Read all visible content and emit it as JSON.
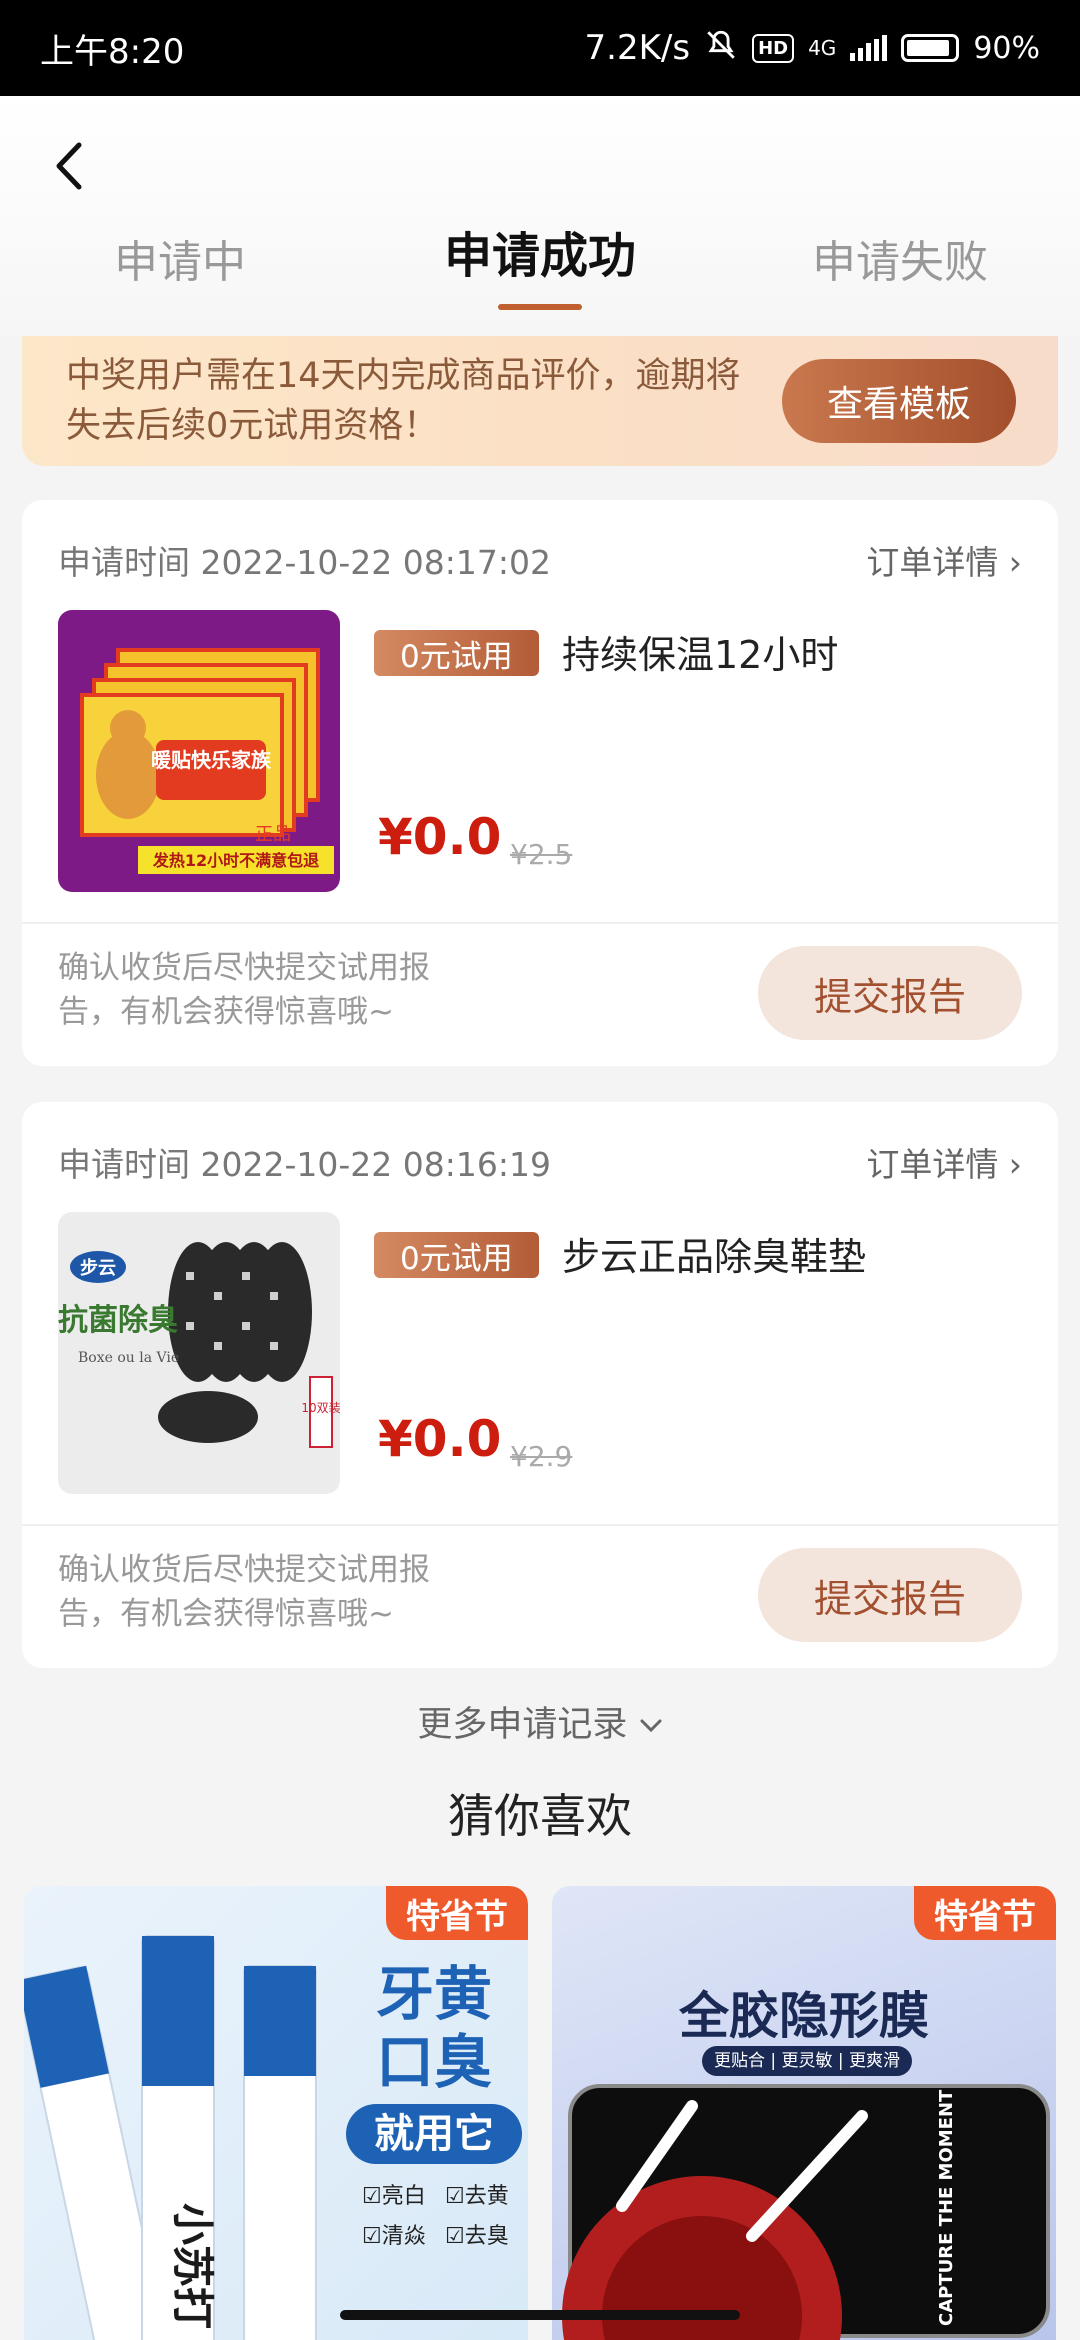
{
  "status_bar": {
    "time": "上午8:20",
    "net_speed": "7.2K/s",
    "hd": "HD",
    "network": "4G",
    "battery": "90%"
  },
  "tabs": [
    {
      "label": "申请中"
    },
    {
      "label": "申请成功"
    },
    {
      "label": "申请失败"
    }
  ],
  "notice": {
    "text": "中奖用户需在14天内完成商品评价，逾期将失去后续0元试用资格！",
    "button": "查看模板"
  },
  "orders": [
    {
      "time": "申请时间 2022-10-22 08:17:02",
      "detail": "订单详情 ›",
      "tag": "0元试用",
      "title": "持续保温12小时",
      "price": "¥0.0",
      "old_price": "¥2.5",
      "image_title": "暖贴快乐家族",
      "image_caption": "发热12小时不满意包退",
      "tip": "确认收货后尽快提交试用报告，有机会获得惊喜哦~",
      "button": "提交报告"
    },
    {
      "time": "申请时间 2022-10-22 08:16:19",
      "detail": "订单详情 ›",
      "tag": "0元试用",
      "title": "步云正品除臭鞋垫",
      "price": "¥0.0",
      "old_price": "¥2.9",
      "image_brand": "步云",
      "image_title": "抗菌除臭",
      "image_caption": "10双装",
      "tip": "确认收货后尽快提交试用报告，有机会获得惊喜哦~",
      "button": "提交报告"
    }
  ],
  "more_records": "更多申请记录",
  "guess_title": "猜你喜欢",
  "recommendations": [
    {
      "badge": "特省节",
      "headline1": "牙黄",
      "headline2": "口臭",
      "slogan": "就用它",
      "product": "小苏打",
      "features": [
        "亮白",
        "去黄",
        "清焱",
        "去臭"
      ]
    },
    {
      "badge": "特省节",
      "headline": "全胶隐形膜",
      "sub": "更贴合 | 更灵敏 | 更爽滑",
      "phone_text": "CAPTURE THE MOMENT"
    }
  ],
  "colors": {
    "accent": "#c06030",
    "price_red": "#cc1d0e",
    "badge": "#ef5a2d"
  }
}
